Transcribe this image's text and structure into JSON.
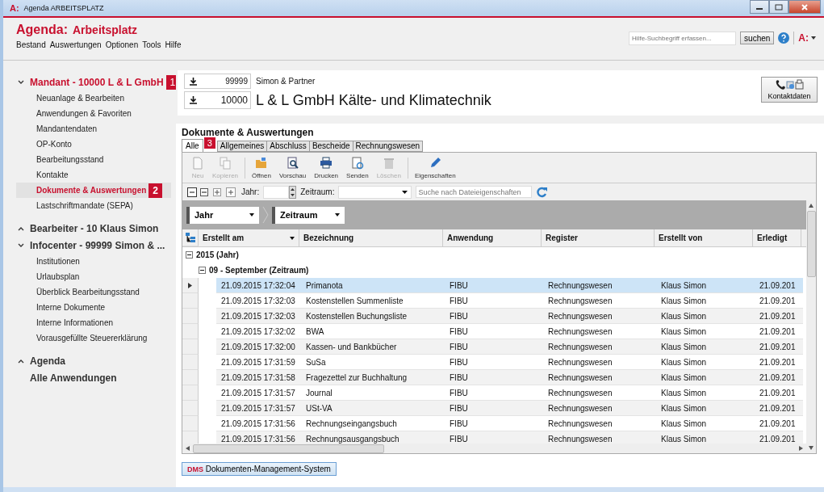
{
  "window": {
    "logo": "A:",
    "title": "Agenda  ARBEITSPLATZ"
  },
  "header": {
    "brand": "Agenda:",
    "app_title": "Arbeitsplatz",
    "menu": [
      "Bestand",
      "Auswertungen",
      "Optionen",
      "Tools",
      "Hilfe"
    ],
    "help_search": {
      "placeholder": "Hilfe-Suchbegriff erfassen..."
    },
    "search_button": "suchen",
    "app_menu": "A:"
  },
  "sidebar": [
    {
      "title": "Mandant - 10000 L & L GmbH",
      "badge": "1",
      "expanded": true,
      "active": true,
      "items": [
        {
          "label": "Neuanlage & Bearbeiten",
          "selected": false
        },
        {
          "label": "Anwendungen & Favoriten",
          "selected": false
        },
        {
          "label": "Mandantendaten",
          "selected": false
        },
        {
          "label": "OP-Konto",
          "selected": false
        },
        {
          "label": "Bearbeitungsstand",
          "selected": false
        },
        {
          "label": "Kontakte",
          "selected": false
        },
        {
          "label": "Dokumente & Auswertungen",
          "selected": true,
          "badge": "2"
        },
        {
          "label": "Lastschriftmandate (SEPA)",
          "selected": false
        }
      ]
    },
    {
      "title": "Bearbeiter - 10 Klaus Simon",
      "expanded": false,
      "active": false
    },
    {
      "title": "Infocenter - 99999 Simon & ...",
      "expanded": true,
      "active": false,
      "items": [
        {
          "label": "Institutionen",
          "selected": false
        },
        {
          "label": "Urlaubsplan",
          "selected": false
        },
        {
          "label": "Überblick Bearbeitungsstand",
          "selected": false
        },
        {
          "label": "Interne Dokumente",
          "selected": false
        },
        {
          "label": "Interne Informationen",
          "selected": false
        },
        {
          "label": "Vorausgefüllte Steuererklärung",
          "selected": false
        }
      ]
    },
    {
      "title": "Agenda",
      "expanded": false,
      "active": false
    },
    {
      "title": "Alle Anwendungen",
      "kind": "link",
      "active": false
    }
  ],
  "clients": [
    {
      "number": "99999",
      "name": "Simon & Partner",
      "large": false
    },
    {
      "number": "10000",
      "name": "L & L GmbH Kälte- und Klimatechnik",
      "large": true
    }
  ],
  "contact_button": "Kontaktdaten",
  "section_title": "Dokumente & Auswertungen",
  "tabs": [
    {
      "label": "Alle",
      "selected": true
    },
    {
      "label": "Allgemeines",
      "selected": false
    },
    {
      "label": "Abschluss",
      "selected": false
    },
    {
      "label": "Bescheide",
      "selected": false
    },
    {
      "label": "Rechnungswesen",
      "selected": false
    }
  ],
  "tab_badge": "3",
  "toolbar": [
    {
      "kind": "new",
      "label": "Neu",
      "disabled": true
    },
    {
      "kind": "copy",
      "label": "Kopieren",
      "disabled": true
    },
    {
      "kind": "sep"
    },
    {
      "kind": "open",
      "label": "Öffnen",
      "disabled": false
    },
    {
      "kind": "preview",
      "label": "Vorschau",
      "disabled": false
    },
    {
      "kind": "print",
      "label": "Drucken",
      "disabled": false
    },
    {
      "kind": "send",
      "label": "Senden",
      "disabled": false
    },
    {
      "kind": "delete",
      "label": "Löschen",
      "disabled": true
    },
    {
      "kind": "sep"
    },
    {
      "kind": "edit",
      "label": "Eigenschaften",
      "disabled": false
    }
  ],
  "filter": {
    "year_label": "Jahr:",
    "period_label": "Zeitraum:",
    "search_placeholder": "Suche nach Dateieigenschaften"
  },
  "group_by": [
    "Jahr",
    "Zeitraum"
  ],
  "table": {
    "columns": [
      "Erstellt am",
      "Bezeichnung",
      "Anwendung",
      "Register",
      "Erstellt von",
      "Erledigt"
    ],
    "groups": [
      {
        "label": "2015 (Jahr)",
        "expanded": true
      },
      {
        "label": "09 - September (Zeitraum)",
        "expanded": true
      }
    ],
    "rows": [
      {
        "cells": [
          "21.09.2015 17:32:04",
          "Primanota",
          "FIBU",
          "Rechnungswesen",
          "Klaus Simon",
          "21.09.201"
        ],
        "selected": true
      },
      {
        "cells": [
          "21.09.2015 17:32:03",
          "Kostenstellen Summenliste",
          "FIBU",
          "Rechnungswesen",
          "Klaus Simon",
          "21.09.201"
        ],
        "selected": false
      },
      {
        "cells": [
          "21.09.2015 17:32:03",
          "Kostenstellen Buchungsliste",
          "FIBU",
          "Rechnungswesen",
          "Klaus Simon",
          "21.09.201"
        ],
        "selected": false
      },
      {
        "cells": [
          "21.09.2015 17:32:02",
          "BWA",
          "FIBU",
          "Rechnungswesen",
          "Klaus Simon",
          "21.09.201"
        ],
        "selected": false
      },
      {
        "cells": [
          "21.09.2015 17:32:00",
          "Kassen- und Bankbücher",
          "FIBU",
          "Rechnungswesen",
          "Klaus Simon",
          "21.09.201"
        ],
        "selected": false
      },
      {
        "cells": [
          "21.09.2015 17:31:59",
          "SuSa",
          "FIBU",
          "Rechnungswesen",
          "Klaus Simon",
          "21.09.201"
        ],
        "selected": false
      },
      {
        "cells": [
          "21.09.2015 17:31:58",
          "Fragezettel zur Buchhaltung",
          "FIBU",
          "Rechnungswesen",
          "Klaus Simon",
          "21.09.201"
        ],
        "selected": false
      },
      {
        "cells": [
          "21.09.2015 17:31:57",
          "Journal",
          "FIBU",
          "Rechnungswesen",
          "Klaus Simon",
          "21.09.201"
        ],
        "selected": false
      },
      {
        "cells": [
          "21.09.2015 17:31:57",
          "USt-VA",
          "FIBU",
          "Rechnungswesen",
          "Klaus Simon",
          "21.09.201"
        ],
        "selected": false
      },
      {
        "cells": [
          "21.09.2015 17:31:56",
          "Rechnungseingangsbuch",
          "FIBU",
          "Rechnungswesen",
          "Klaus Simon",
          "21.09.201"
        ],
        "selected": false
      },
      {
        "cells": [
          "21.09.2015 17:31:56",
          "Rechnungsausgangsbuch",
          "FIBU",
          "Rechnungswesen",
          "Klaus Simon",
          "21.09.201"
        ],
        "selected": false
      }
    ]
  },
  "dms_button": {
    "logo": "DMS",
    "label": "Dokumenten-Management-System"
  }
}
